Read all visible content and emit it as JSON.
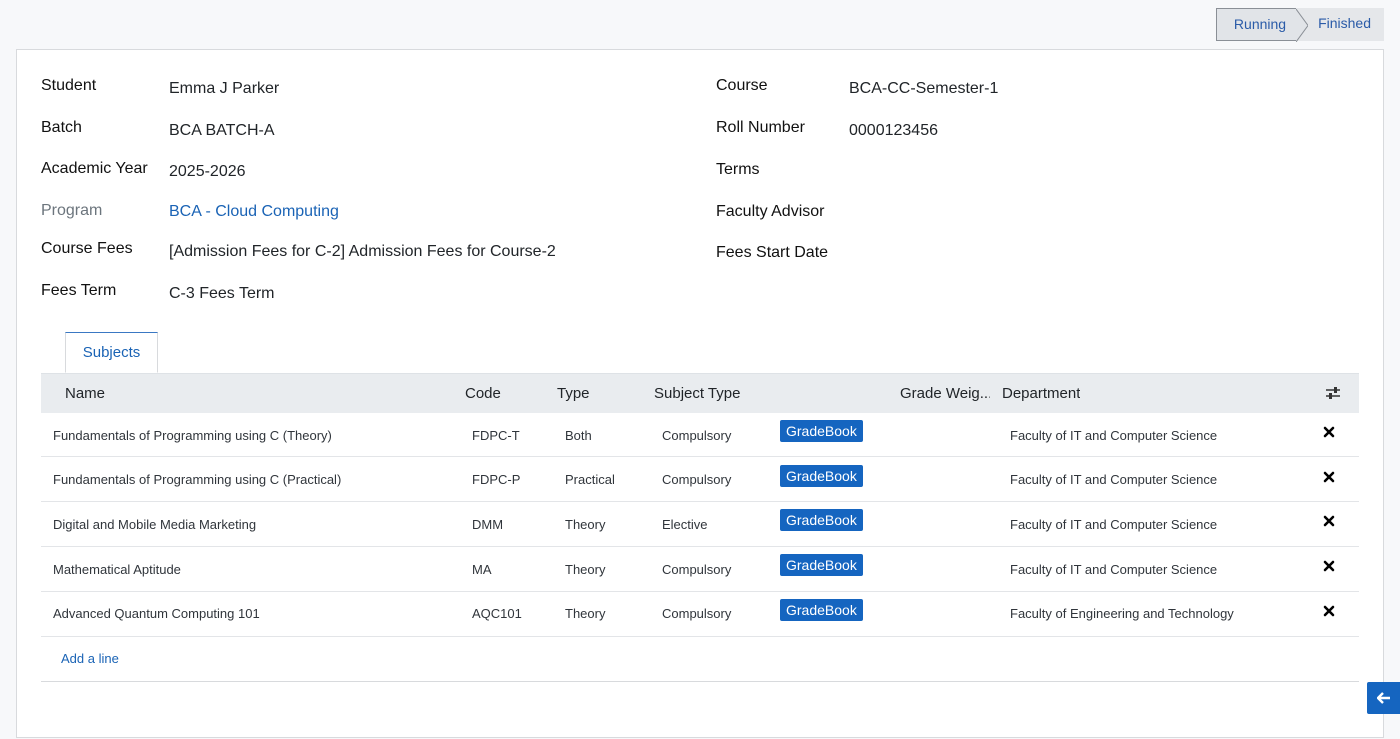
{
  "statusbar": {
    "stages": [
      "Running",
      "Finished"
    ],
    "active": "Running"
  },
  "form": {
    "left": [
      {
        "label": "Student",
        "value": "Emma J Parker"
      },
      {
        "label": "Batch",
        "value": "BCA BATCH-A"
      },
      {
        "label": "Academic Year",
        "value": "2025-2026"
      },
      {
        "label": "Program",
        "value": "BCA - Cloud Computing"
      },
      {
        "label": "Course Fees",
        "value": "[Admission Fees for C-2] Admission Fees for Course-2"
      },
      {
        "label": "Fees Term",
        "value": "C-3 Fees Term"
      }
    ],
    "right": [
      {
        "label": "Course",
        "value": "BCA-CC-Semester-1"
      },
      {
        "label": "Roll Number",
        "value": "0000123456"
      },
      {
        "label": "Terms",
        "value": ""
      },
      {
        "label": "Faculty Advisor",
        "value": ""
      },
      {
        "label": "Fees Start Date",
        "value": ""
      }
    ]
  },
  "tabs": {
    "subjects_label": "Subjects"
  },
  "table": {
    "columns": [
      "Name",
      "Code",
      "Type",
      "Subject Type",
      "Grade Weig...",
      "Department"
    ],
    "gradebook_label": "GradeBook",
    "rows": [
      {
        "name": "Fundamentals of Programming using C (Theory)",
        "code": "FDPC-T",
        "type": "Both",
        "subject_type": "Compulsory",
        "department": "Faculty of IT and Computer Science"
      },
      {
        "name": "Fundamentals of Programming using C (Practical)",
        "code": "FDPC-P",
        "type": "Practical",
        "subject_type": "Compulsory",
        "department": "Faculty of IT and Computer Science"
      },
      {
        "name": "Digital and Mobile Media Marketing",
        "code": "DMM",
        "type": "Theory",
        "subject_type": "Elective",
        "department": "Faculty of IT and Computer Science"
      },
      {
        "name": "Mathematical Aptitude",
        "code": "MA",
        "type": "Theory",
        "subject_type": "Compulsory",
        "department": "Faculty of IT and Computer Science"
      },
      {
        "name": "Advanced Quantum Computing 101",
        "code": "AQC101",
        "type": "Theory",
        "subject_type": "Compulsory",
        "department": "Faculty of Engineering and Technology"
      }
    ],
    "add_line_label": "Add a line"
  },
  "icons": {
    "settings": "sliders-icon",
    "delete": "close-icon",
    "back": "arrow-left-icon"
  },
  "colors": {
    "primary": "#1565c0",
    "link": "#1a63b5"
  }
}
